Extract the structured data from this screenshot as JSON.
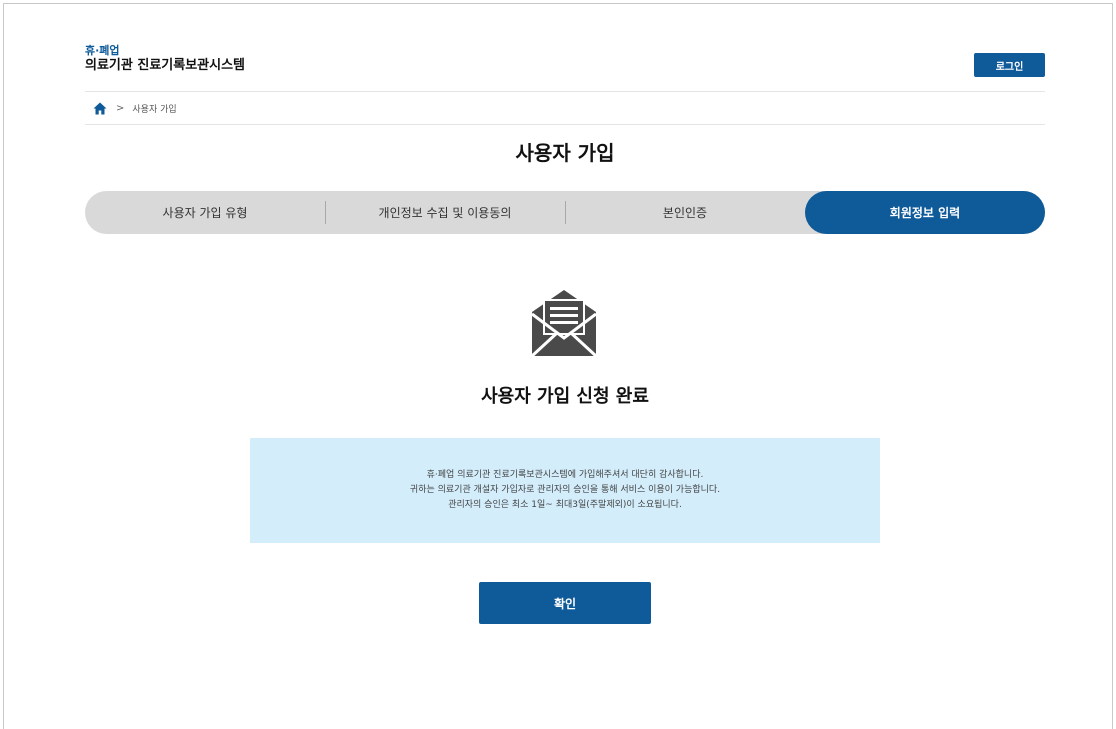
{
  "header": {
    "brand_top": "휴·폐업",
    "brand_main": "의료기관 진료기록보관시스템",
    "login_label": "로그인"
  },
  "breadcrumb": {
    "home_icon": "home-icon",
    "separator": ">",
    "current": "사용자 가입"
  },
  "page_title": "사용자 가입",
  "steps": [
    {
      "label": "사용자 가입 유형",
      "active": false
    },
    {
      "label": "개인정보 수집 및 이용동의",
      "active": false
    },
    {
      "label": "본인인증",
      "active": false
    },
    {
      "label": "회원정보 입력",
      "active": true
    }
  ],
  "result": {
    "icon": "envelope-letter-icon",
    "title": "사용자 가입 신청 완료"
  },
  "notice": {
    "lines": [
      "휴·폐업 의료기관 진료기록보관시스템에 가입해주셔서 대단히 감사합니다.",
      "귀하는 의료기관 개설자 가입자로 관리자의 승인을 통해 서비스 이용이 가능합니다.",
      "관리자의 승인은 최소 1일~ 최대3일(주말제외)이 소요됩니다."
    ]
  },
  "confirm_label": "확인",
  "colors": {
    "primary": "#0f5b9a",
    "stepper_bg": "#d9d9d9",
    "notice_bg": "#d3edfb",
    "icon": "#4a4a4a"
  }
}
